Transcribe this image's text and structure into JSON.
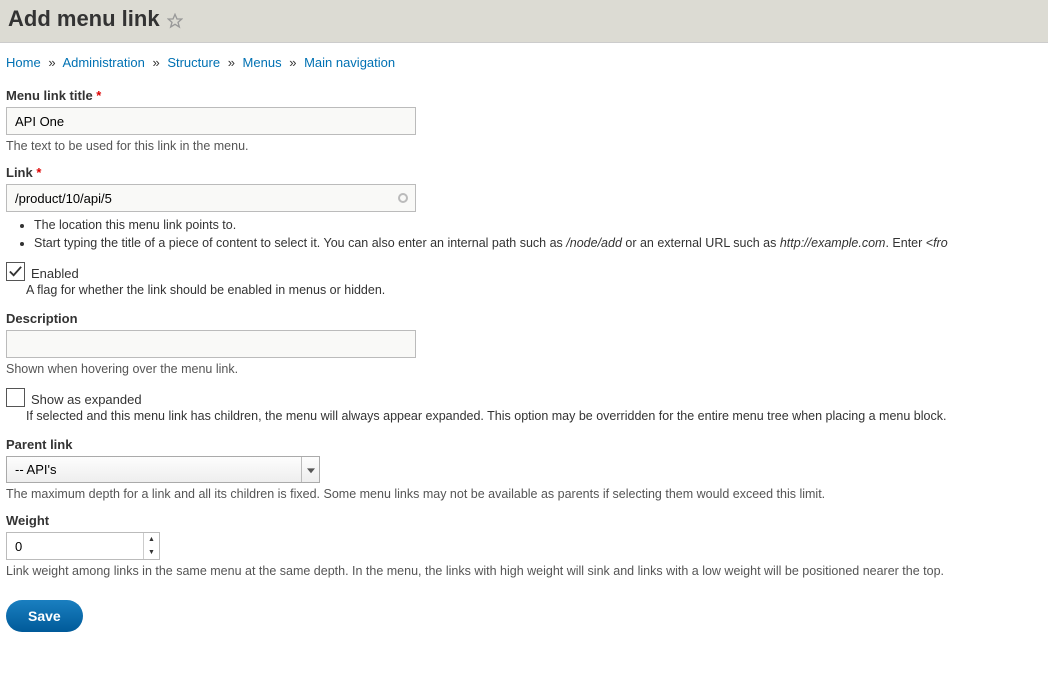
{
  "header": {
    "title": "Add menu link"
  },
  "breadcrumb": {
    "items": [
      "Home",
      "Administration",
      "Structure",
      "Menus",
      "Main navigation"
    ]
  },
  "form": {
    "title": {
      "label": "Menu link title",
      "value": "API One",
      "help": "The text to be used for this link in the menu."
    },
    "link": {
      "label": "Link",
      "value": "/product/10/api/5",
      "bullets": {
        "b1": "The location this menu link points to.",
        "b2_a": "Start typing the title of a piece of content to select it. You can also enter an internal path such as ",
        "b2_em1": "/node/add",
        "b2_b": " or an external URL such as ",
        "b2_em2": "http://example.com",
        "b2_c": ". Enter ",
        "b2_em3": "<fro"
      }
    },
    "enabled": {
      "label": "Enabled",
      "checked": true,
      "help": "A flag for whether the link should be enabled in menus or hidden."
    },
    "description": {
      "label": "Description",
      "value": "",
      "help": "Shown when hovering over the menu link."
    },
    "expanded": {
      "label": "Show as expanded",
      "checked": false,
      "help": "If selected and this menu link has children, the menu will always appear expanded. This option may be overridden for the entire menu tree when placing a menu block."
    },
    "parent": {
      "label": "Parent link",
      "value": "-- API's",
      "help": "The maximum depth for a link and all its children is fixed. Some menu links may not be available as parents if selecting them would exceed this limit."
    },
    "weight": {
      "label": "Weight",
      "value": "0",
      "help": "Link weight among links in the same menu at the same depth. In the menu, the links with high weight will sink and links with a low weight will be positioned nearer the top."
    },
    "save": "Save"
  }
}
